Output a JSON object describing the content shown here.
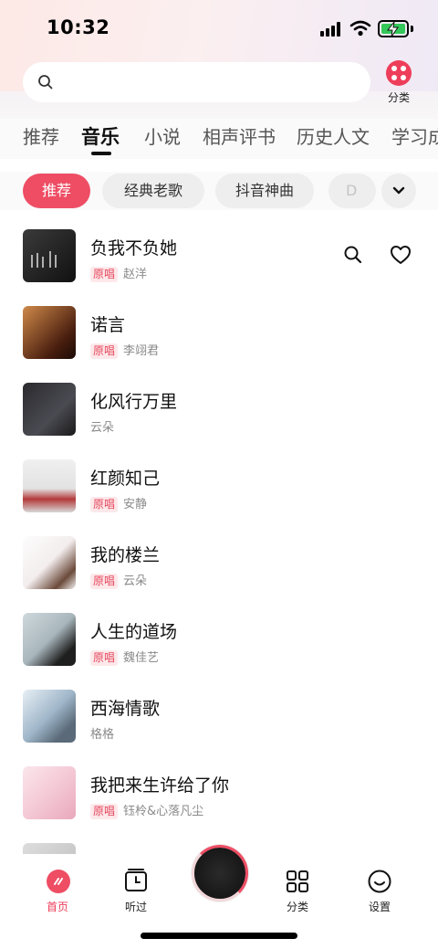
{
  "status_bar": {
    "time": "10:32"
  },
  "search": {
    "placeholder": ""
  },
  "category_button": {
    "label": "分类"
  },
  "tabs": [
    {
      "label": "推荐"
    },
    {
      "label": "音乐"
    },
    {
      "label": "小说"
    },
    {
      "label": "相声评书"
    },
    {
      "label": "历史人文"
    },
    {
      "label": "学习成"
    }
  ],
  "chips": [
    {
      "label": "推荐"
    },
    {
      "label": "经典老歌"
    },
    {
      "label": "抖音神曲"
    },
    {
      "label": "D"
    }
  ],
  "songs": [
    {
      "title": "负我不负她",
      "badge": "原唱",
      "artist": "赵洋"
    },
    {
      "title": "诺言",
      "badge": "原唱",
      "artist": "李翊君"
    },
    {
      "title": "化风行万里",
      "badge": "",
      "artist": "云朵"
    },
    {
      "title": "红颜知己",
      "badge": "原唱",
      "artist": "安静"
    },
    {
      "title": "我的楼兰",
      "badge": "原唱",
      "artist": "云朵"
    },
    {
      "title": "人生的道场",
      "badge": "原唱",
      "artist": "魏佳艺"
    },
    {
      "title": "西海情歌",
      "badge": "",
      "artist": "格格"
    },
    {
      "title": "我把来生许给了你",
      "badge": "原唱",
      "artist": "钰柃&心落凡尘"
    }
  ],
  "bottom_nav": {
    "home": "首页",
    "history": "听过",
    "category": "分类",
    "settings": "设置"
  },
  "colors": {
    "accent": "#ee3d5a",
    "badge_bg": "#fde8ea"
  }
}
